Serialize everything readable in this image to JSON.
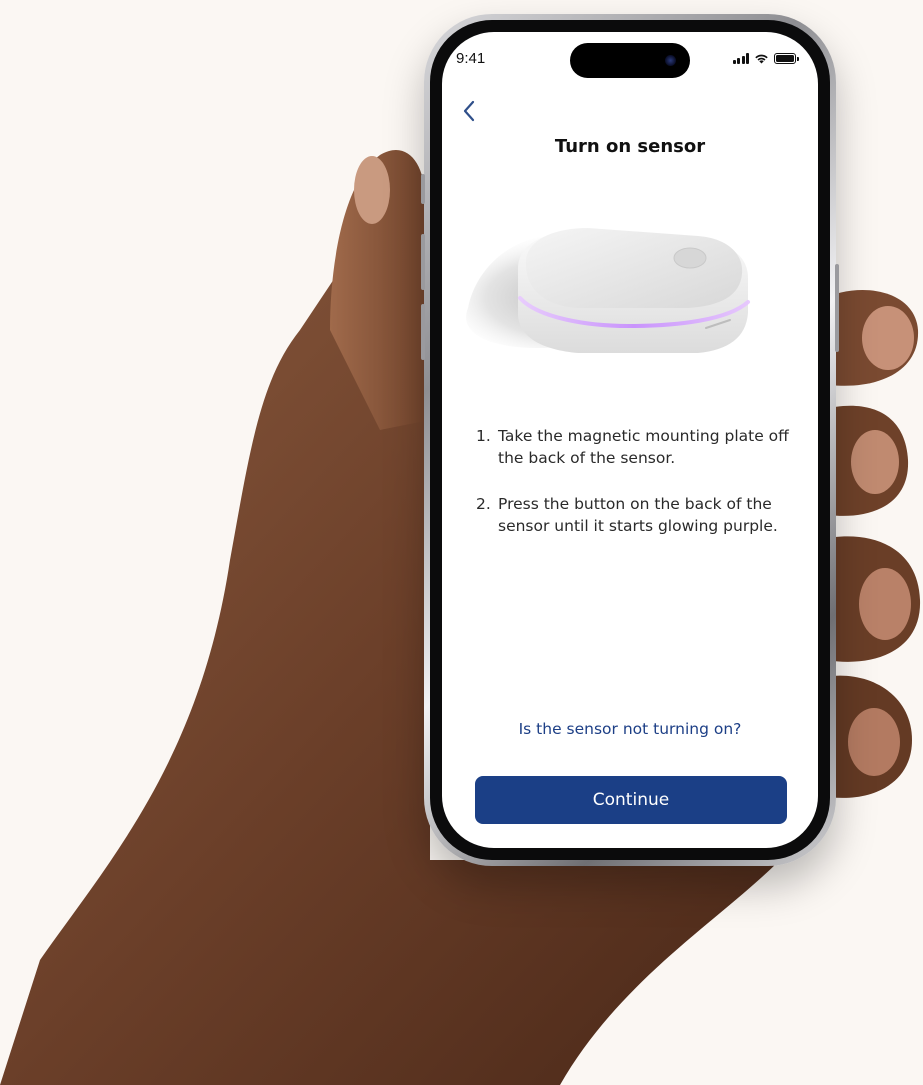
{
  "status_bar": {
    "time": "9:41"
  },
  "nav": {
    "back_icon": "chevron-left-icon"
  },
  "screen": {
    "title": "Turn on sensor",
    "steps": [
      {
        "number": "1.",
        "text": "Take the magnetic mounting plate off the back of the sensor."
      },
      {
        "number": "2.",
        "text": "Press the button on the back of the sensor until it starts glowing purple."
      }
    ],
    "help_link": "Is the sensor not turning on?",
    "continue_label": "Continue"
  },
  "colors": {
    "primary": "#1b3f86",
    "link": "#1d3f86",
    "glow": "#d7a6ff",
    "background": "#fbf7f3"
  }
}
